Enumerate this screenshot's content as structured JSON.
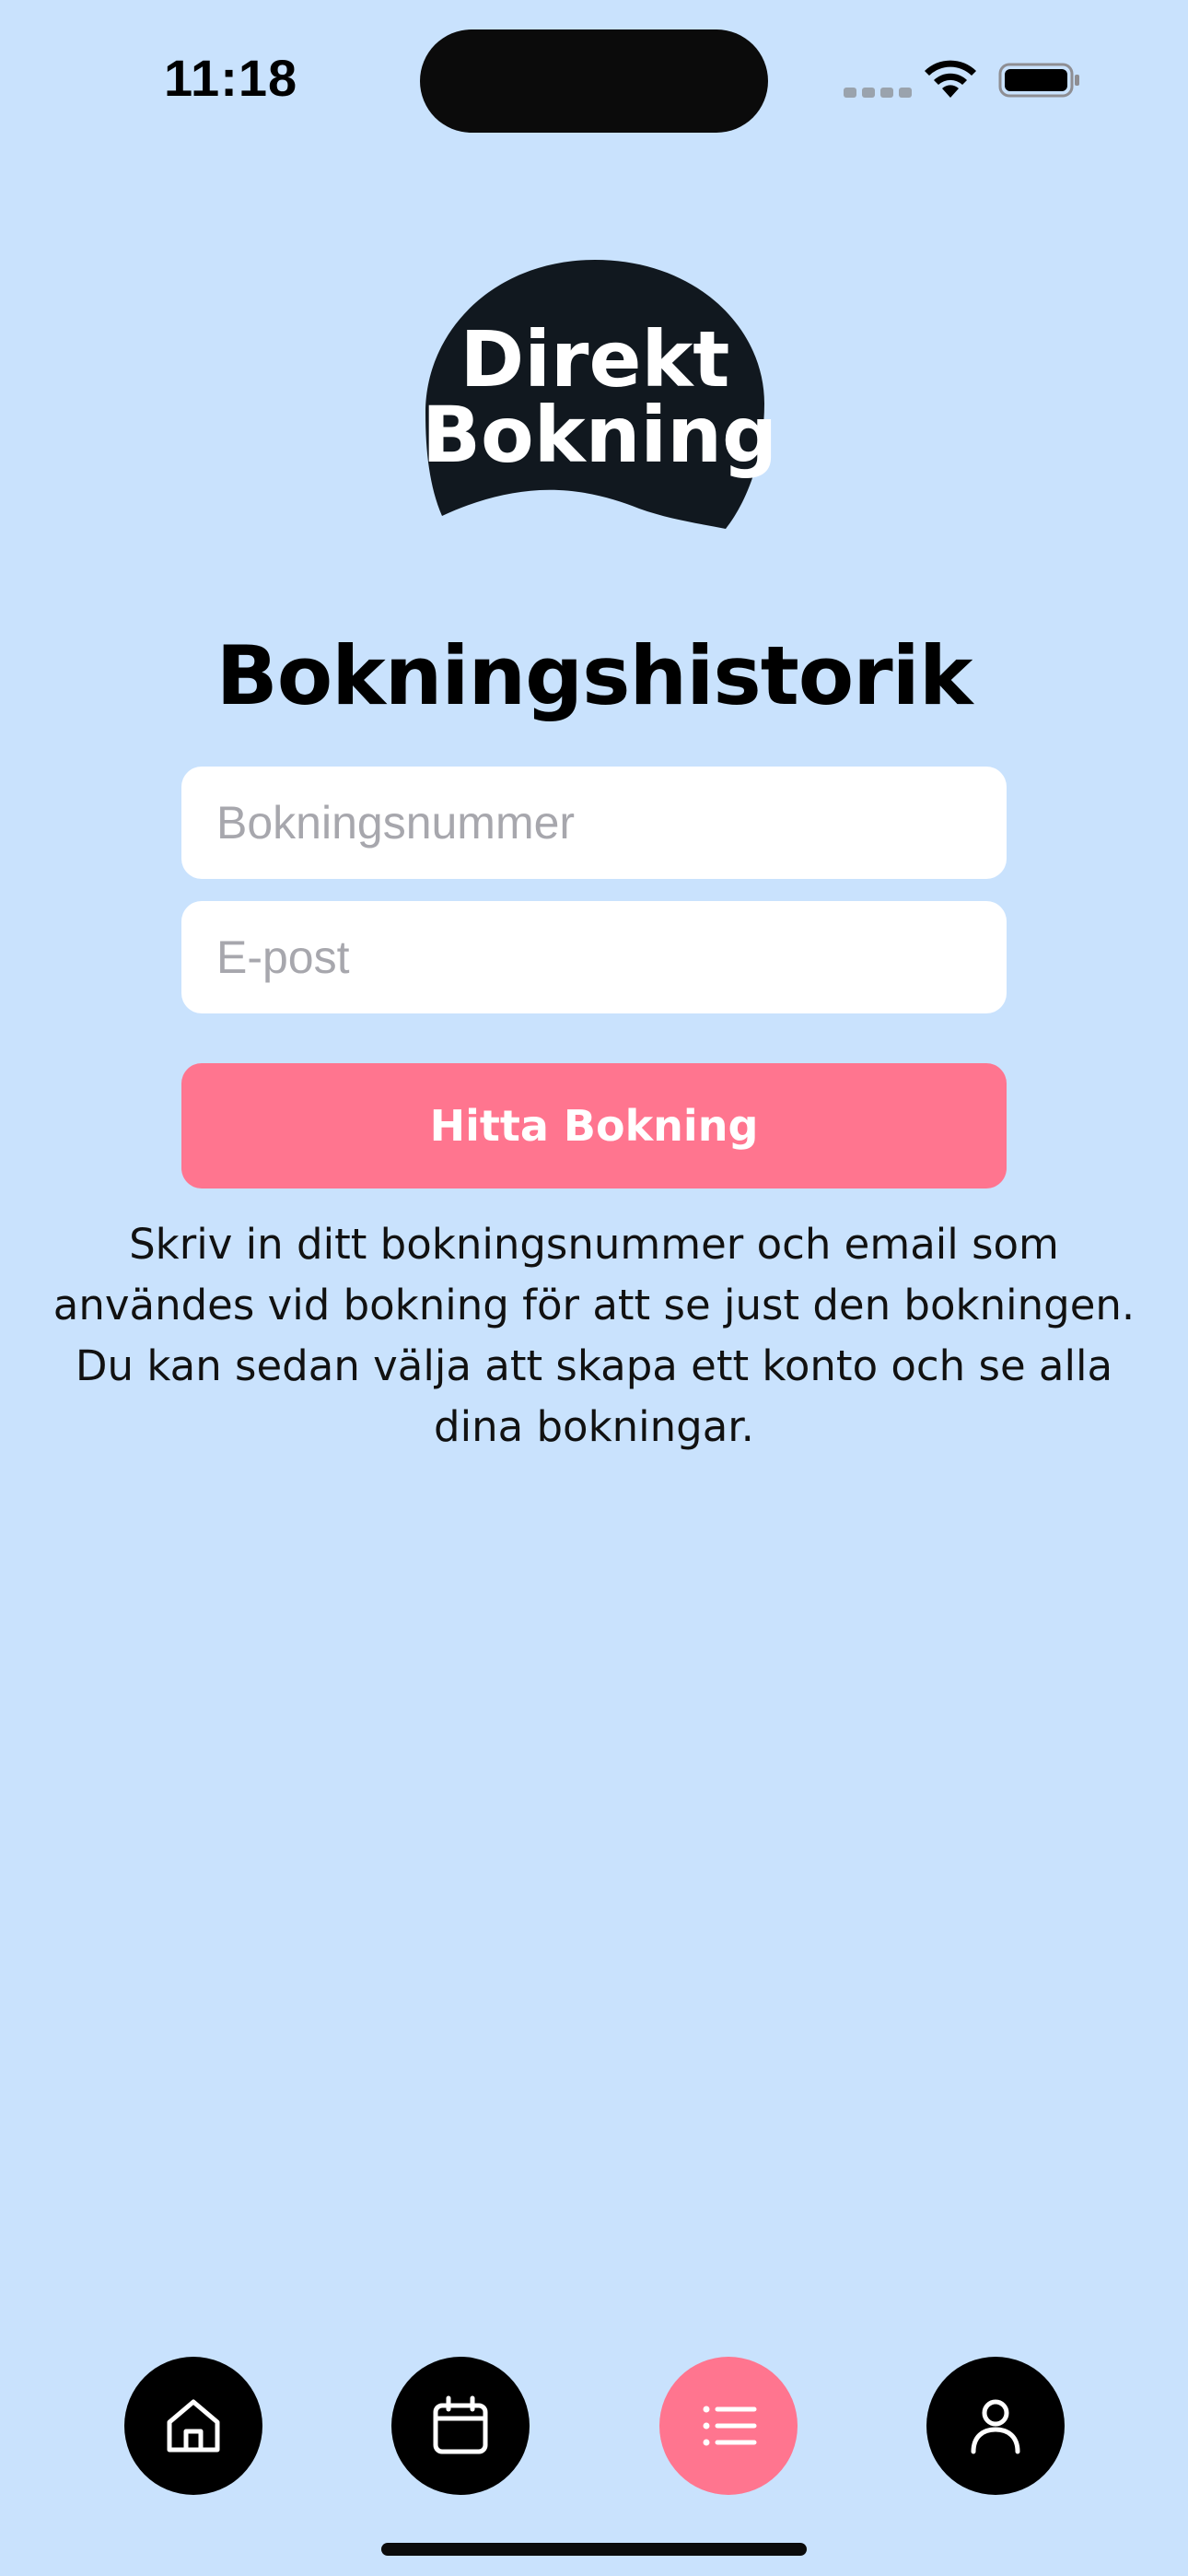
{
  "status_bar": {
    "time": "11:18"
  },
  "logo": {
    "line1": "Direkt",
    "line2": "Bokning"
  },
  "page": {
    "title": "Bokningshistorik",
    "help_text": "Skriv in ditt bokningsnummer och email som användes vid bokning för att se just den bokningen. Du kan sedan välja att skapa ett konto och se alla dina bokningar."
  },
  "form": {
    "booking_number": {
      "value": "",
      "placeholder": "Bokningsnummer"
    },
    "email": {
      "value": "",
      "placeholder": "E-post"
    },
    "submit_label": "Hitta Bokning"
  },
  "nav": {
    "items": [
      {
        "icon": "home-icon"
      },
      {
        "icon": "calendar-icon"
      },
      {
        "icon": "list-icon",
        "active": true
      },
      {
        "icon": "profile-icon"
      }
    ]
  },
  "colors": {
    "background": "#c9e2fd",
    "accent": "#ff758f",
    "dark": "#0b0b0b",
    "logo_bg": "#11181f"
  }
}
